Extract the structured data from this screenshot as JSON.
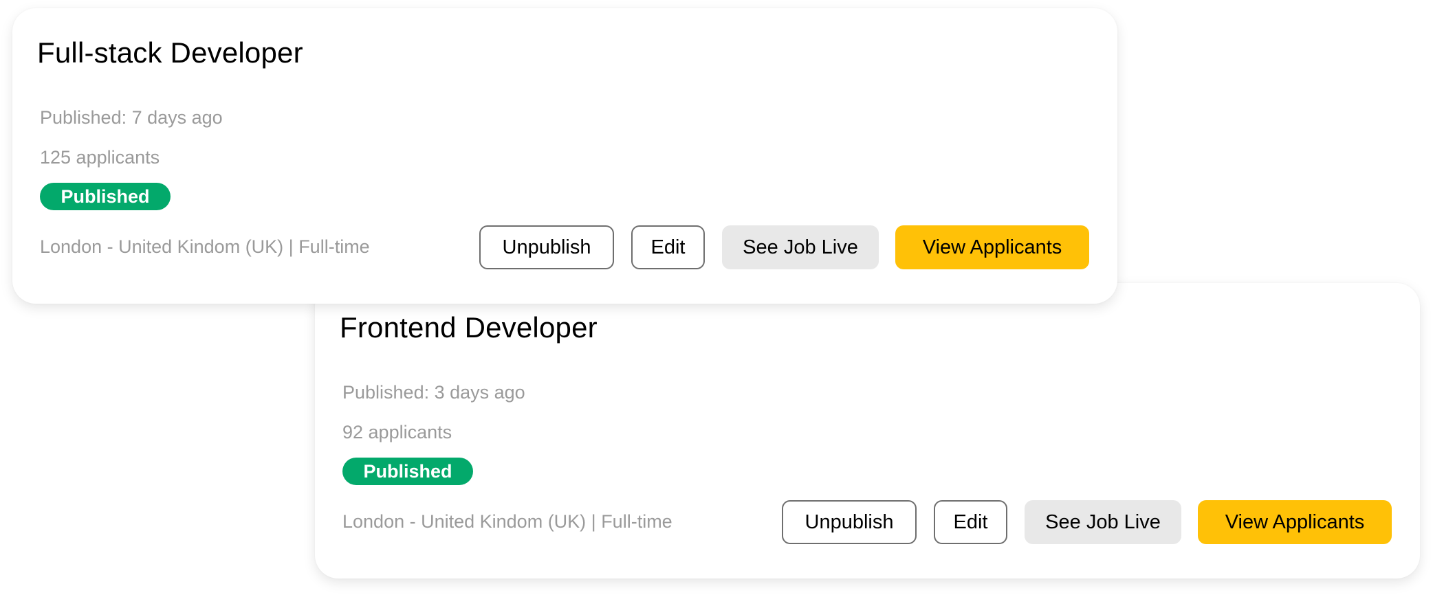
{
  "colors": {
    "published_badge": "#03a96b",
    "primary_button": "#ffc107",
    "secondary_button": "#e8e8e8",
    "muted_text": "#9a9a9a"
  },
  "jobs": [
    {
      "title": "Full-stack Developer",
      "published_date": "Published: 7 days ago",
      "applicants": "125 applicants",
      "status": "Published",
      "location": "London - United Kindom (UK) | Full-time",
      "actions": {
        "unpublish": "Unpublish",
        "edit": "Edit",
        "see_live": "See Job Live",
        "view_applicants": "View Applicants"
      }
    },
    {
      "title": "Frontend Developer",
      "published_date": "Published: 3 days ago",
      "applicants": "92 applicants",
      "status": "Published",
      "location": "London - United Kindom (UK) | Full-time",
      "actions": {
        "unpublish": "Unpublish",
        "edit": "Edit",
        "see_live": "See Job Live",
        "view_applicants": "View Applicants"
      }
    }
  ]
}
